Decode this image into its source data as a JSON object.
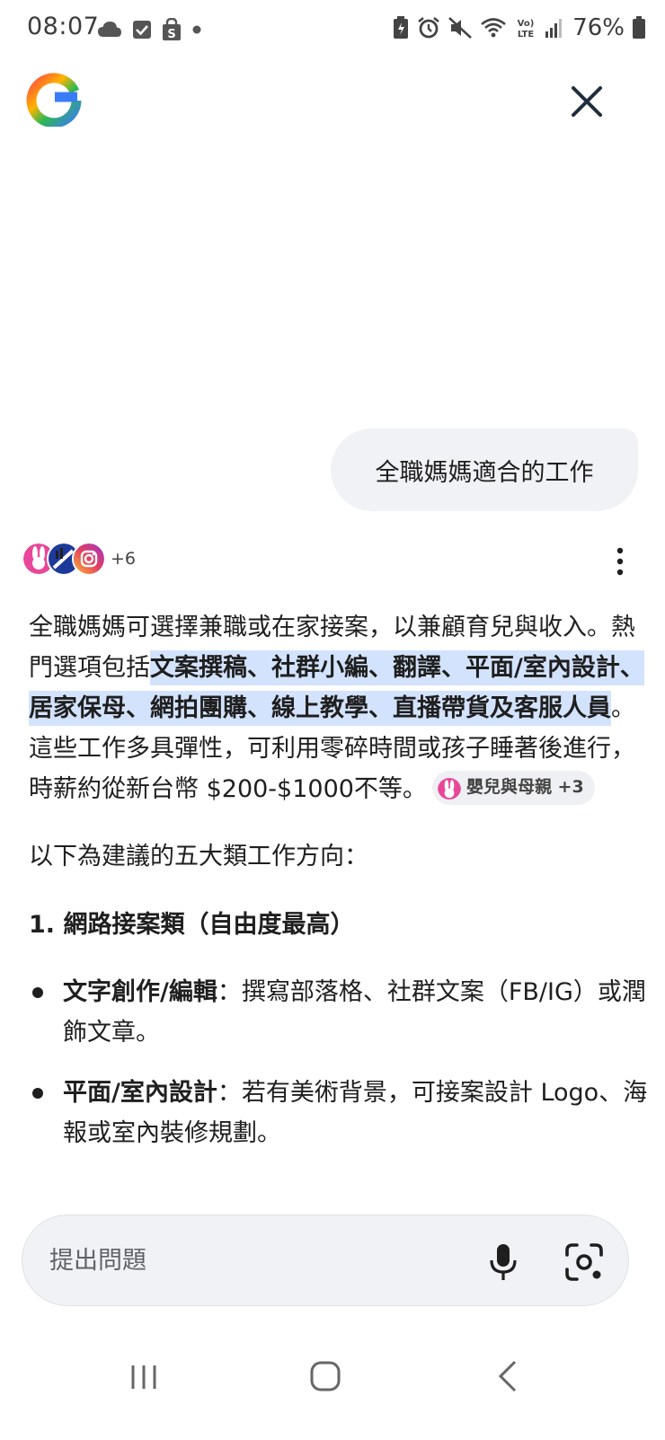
{
  "status_bar": {
    "time": "08:07",
    "battery": "76%",
    "left_icons": [
      "cloud-icon",
      "checkbox-icon",
      "shopping-bag-icon",
      "dot-icon"
    ],
    "right_icons": [
      "battery-saver-icon",
      "alarm-icon",
      "mute-icon",
      "wifi-icon",
      "volte-icon",
      "signal-icon",
      "battery-icon"
    ]
  },
  "header": {
    "logo_icon": "google-g-logo",
    "close_icon": "close-icon"
  },
  "conversation": {
    "user_query": "全職媽媽適合的工作",
    "sources_more": "+6",
    "answer": {
      "p1_plain_a": "全職媽媽可選擇兼職或在家接案，以兼顧育兒與收入。熱門選項包括",
      "p1_highlight": "文案撰稿、社群小編、翻譯、平面/室內設計、居家保母、網拍團購、線上教學、直播帶貨及客服人員",
      "p1_plain_b": "。這些工作多具彈性，可利用零碎時間或孩子睡著後進行，時薪約從新台幣 $200-$1000不等。",
      "citation_chip": "嬰兒與母親 +3",
      "intro": "以下為建議的五大類工作方向：",
      "section_1_title": "1. 網路接案類（自由度最高）",
      "bullets": [
        {
          "title": "文字創作/編輯",
          "text": "：撰寫部落格、社群文案（FB/IG）或潤飾文章。"
        },
        {
          "title": "平面/室內設計",
          "text": "：若有美術背景，可接案設計 Logo、海報或室內裝修規劃。"
        }
      ]
    }
  },
  "input": {
    "placeholder": "提出問題",
    "mic_icon": "microphone-icon",
    "lens_icon": "camera-lens-icon"
  },
  "colors": {
    "highlight": "#d3e3fd",
    "bubble": "#f0f2f5",
    "text": "#1f1f1f"
  },
  "nav_bar": [
    "recents-icon",
    "home-icon",
    "back-icon"
  ]
}
